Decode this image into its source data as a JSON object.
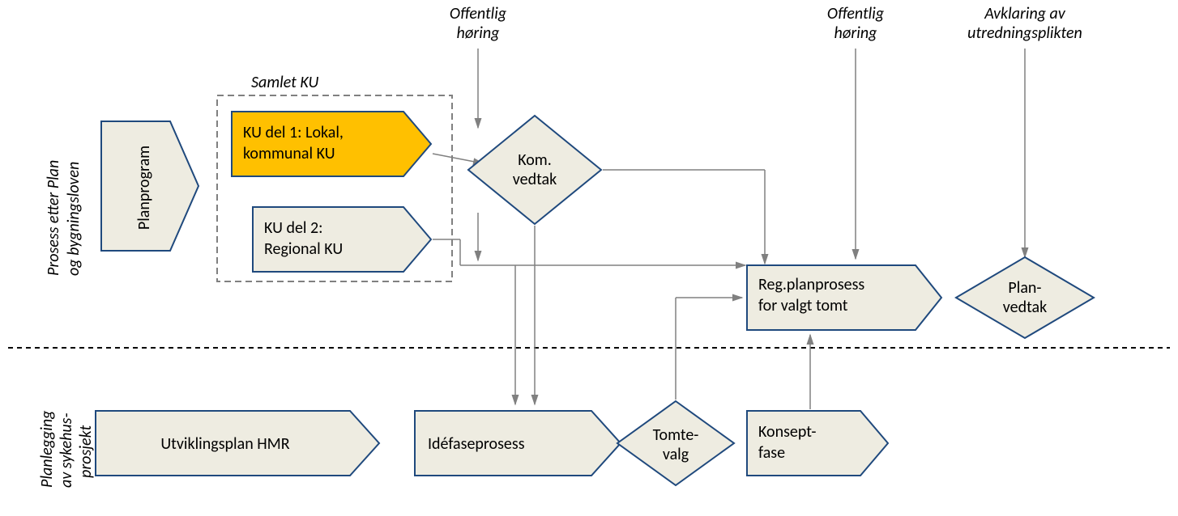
{
  "annotations": {
    "offentlig_horing_1_l1": "Offentlig",
    "offentlig_horing_1_l2": "høring",
    "offentlig_horing_2_l1": "Offentlig",
    "offentlig_horing_2_l2": "høring",
    "avklaring_l1": "Avklaring av",
    "avklaring_l2": "utredningsplikten",
    "samlet_ku": "Samlet KU"
  },
  "swimlane1_l1": "Prosess etter Plan",
  "swimlane1_l2": "og bygningsloven",
  "swimlane2_l1": "Planlegging",
  "swimlane2_l2": "av sykehus-",
  "swimlane2_l3": "prosjekt",
  "shapes": {
    "planprogram": "Planprogram",
    "ku1_l1": "KU del 1: Lokal,",
    "ku1_l2": "kommunal KU",
    "ku2_l1": "KU del 2:",
    "ku2_l2": "Regional KU",
    "kom_vedtak_l1": "Kom.",
    "kom_vedtak_l2": "vedtak",
    "regplan_l1": "Reg.planprosess",
    "regplan_l2": "for valgt tomt",
    "plan_vedtak_l1": "Plan-",
    "plan_vedtak_l2": "vedtak",
    "utviklingsplan": "Utviklingsplan HMR",
    "idefase": "Idéfaseprosess",
    "tomtevalg_l1": "Tomte-",
    "tomtevalg_l2": "valg",
    "konsept_l1": "Konsept-",
    "konsept_l2": "fase"
  }
}
